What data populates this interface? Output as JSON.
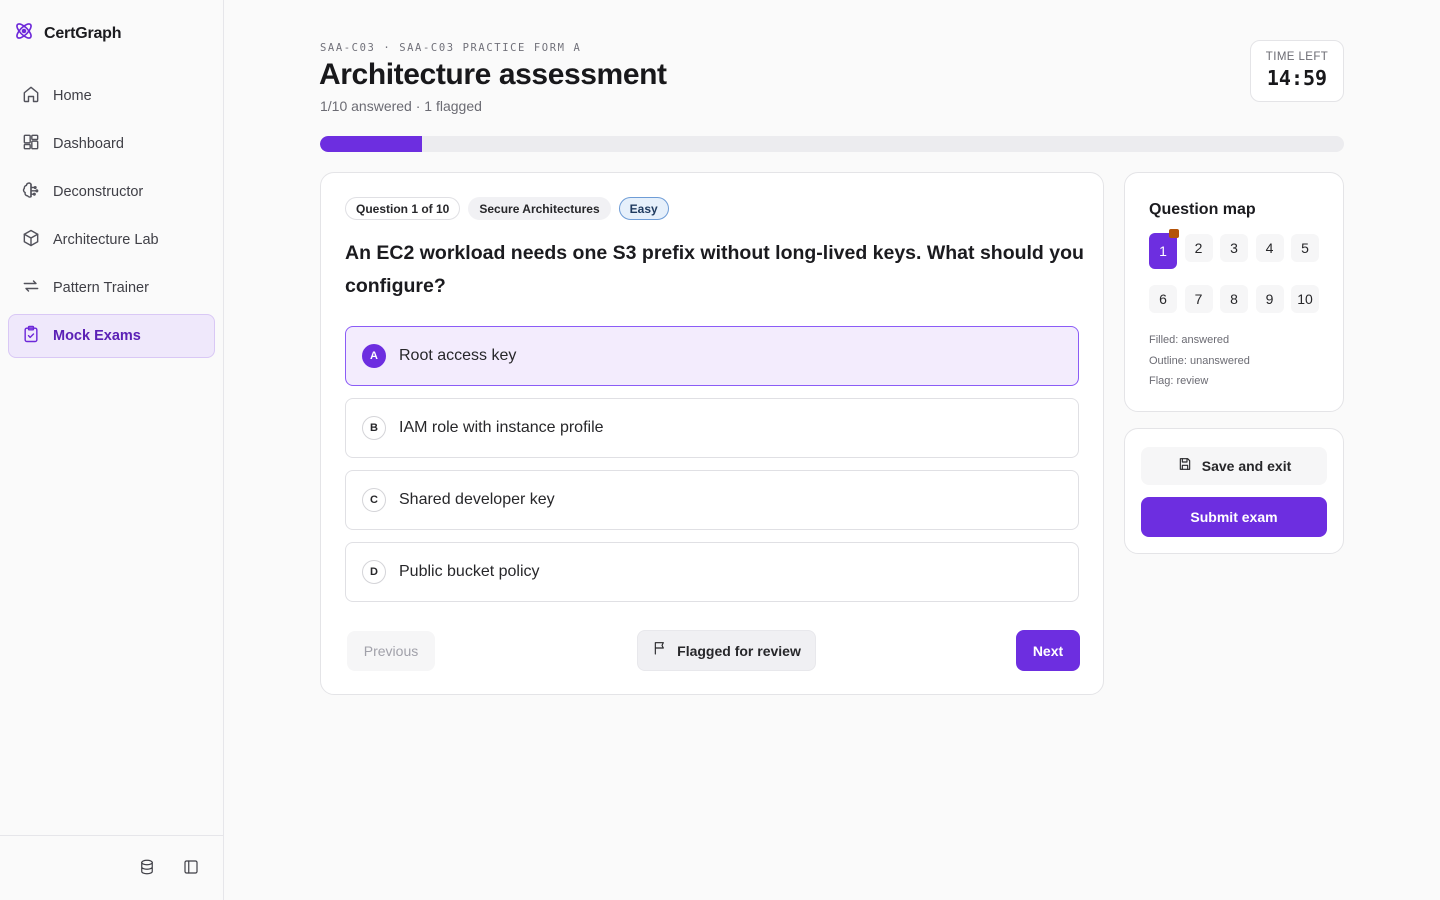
{
  "app": {
    "name": "CertGraph",
    "logo_icon": "atom-icon",
    "accent": "#6d2ee0"
  },
  "sidebar": {
    "items": [
      {
        "label": "Home",
        "icon": "home-icon"
      },
      {
        "label": "Dashboard",
        "icon": "dashboard-icon"
      },
      {
        "label": "Deconstructor",
        "icon": "brain-icon"
      },
      {
        "label": "Architecture Lab",
        "icon": "cube-icon"
      },
      {
        "label": "Pattern Trainer",
        "icon": "repeat-icon"
      },
      {
        "label": "Mock Exams",
        "icon": "clipboard-check-icon",
        "active": true
      }
    ],
    "footer": [
      "database-icon",
      "panel-toggle-icon"
    ]
  },
  "header": {
    "eyebrow": "SAA-C03 · SAA-C03 PRACTICE FORM A",
    "title": "Architecture assessment",
    "subtitle": "1/10 answered · 1 flagged",
    "timer_label": "TIME LEFT",
    "timer_value": "14:59",
    "progress_fraction": 0.1
  },
  "question": {
    "chips": {
      "position": "Question 1 of 10",
      "domain": "Secure Architectures",
      "difficulty": "Easy"
    },
    "text": "An EC2 workload needs one S3 prefix without long-lived keys. What should you configure?",
    "options": [
      {
        "letter": "A",
        "text": "Root access key",
        "selected": true
      },
      {
        "letter": "B",
        "text": "IAM role with instance profile",
        "selected": false
      },
      {
        "letter": "C",
        "text": "Shared developer key",
        "selected": false
      },
      {
        "letter": "D",
        "text": "Public bucket policy",
        "selected": false
      }
    ],
    "prev_label": "Previous",
    "flag_label": "Flagged for review",
    "next_label": "Next"
  },
  "question_map": {
    "title": "Question map",
    "numbers": [
      "1",
      "2",
      "3",
      "4",
      "5",
      "6",
      "7",
      "8",
      "9",
      "10"
    ],
    "current": 1,
    "flagged": [
      1
    ],
    "legend": [
      "Filled: answered",
      "Outline: unanswered",
      "Flag: review"
    ]
  },
  "actions": {
    "save_label": "Save and exit",
    "submit_label": "Submit exam"
  }
}
